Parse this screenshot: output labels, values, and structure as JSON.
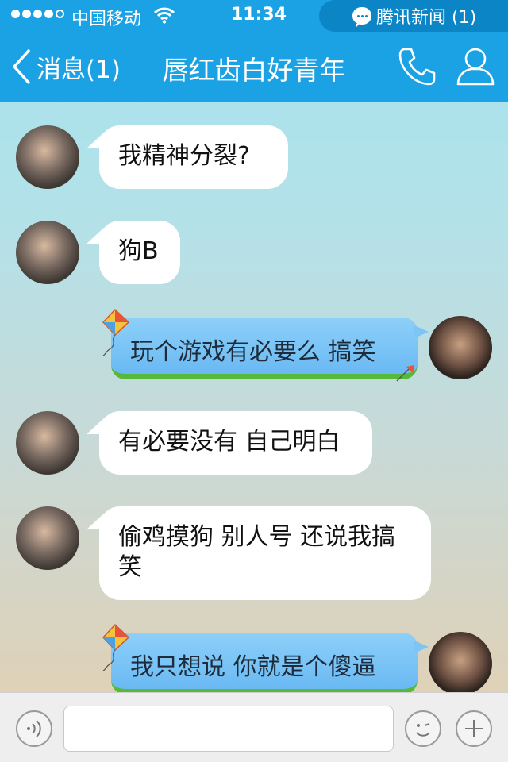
{
  "status_bar": {
    "carrier": "中国移动",
    "time": "11:34",
    "signal_bars_filled": 4,
    "notification": "腾讯新闻 (1)"
  },
  "nav": {
    "back_label": "消息(1)",
    "title": "唇红齿白好青年"
  },
  "messages": [
    {
      "from": "contact",
      "text": "我精神分裂?"
    },
    {
      "from": "contact",
      "text": "狗B"
    },
    {
      "from": "me",
      "text": "玩个游戏有必要么  搞笑"
    },
    {
      "from": "contact",
      "text": "有必要没有  自己明白"
    },
    {
      "from": "contact",
      "text": "偷鸡摸狗  别人号  还说我搞笑"
    },
    {
      "from": "me",
      "text": "我只想说  你就是个傻逼"
    }
  ],
  "input_bar": {
    "message_placeholder": ""
  },
  "colors": {
    "header": "#1aa2e4",
    "notification_pill": "#0b85c6",
    "outgoing_bubble": "#7cc4f6",
    "outgoing_bubble_grass": "#56b93a",
    "incoming_bubble": "#ffffff"
  },
  "icons": [
    "wifi-icon",
    "chat-bubble-icon",
    "back-chevron-icon",
    "phone-icon",
    "contact-icon",
    "kite-icon",
    "voice-icon",
    "emoji-icon",
    "plus-icon"
  ]
}
